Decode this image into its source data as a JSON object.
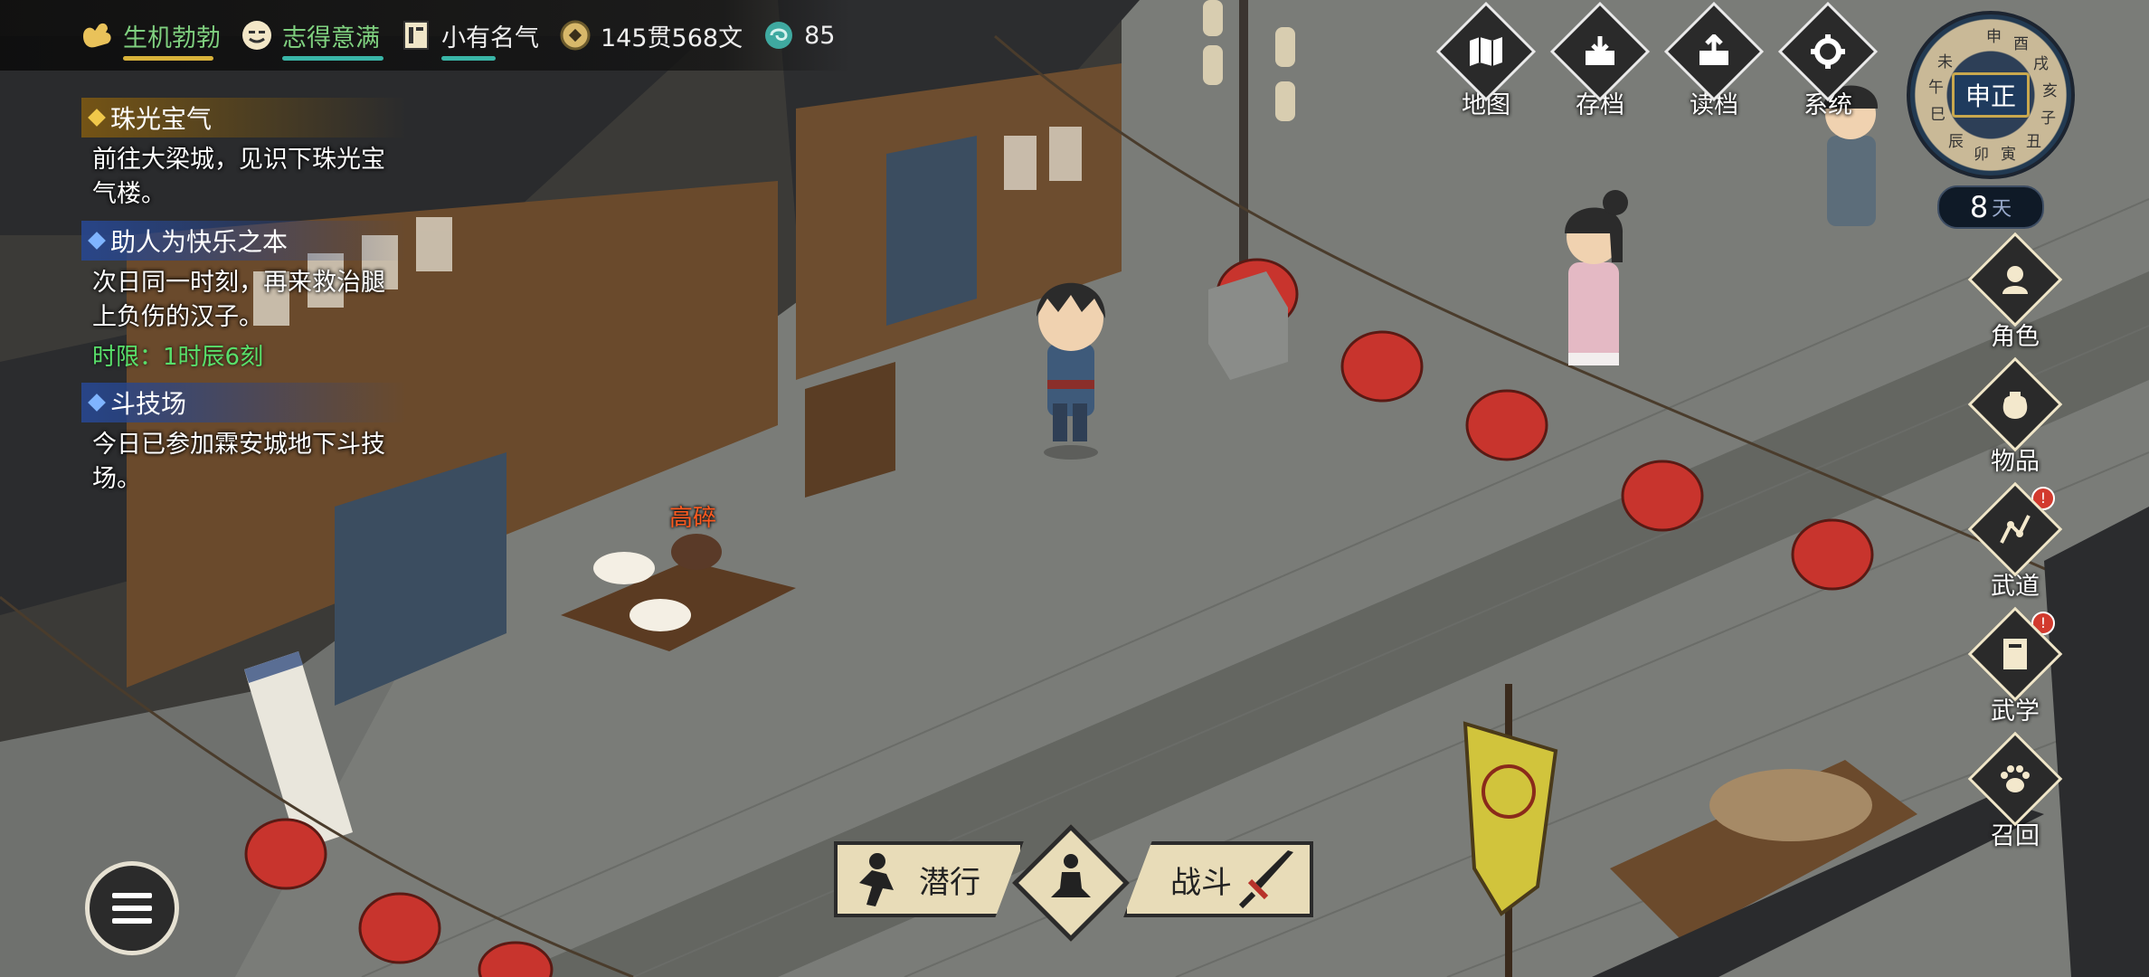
{
  "status_bar": {
    "health": {
      "label": "生机勃勃",
      "icon": "muscle-icon",
      "bar_color": "#d8b23a"
    },
    "mood": {
      "label": "志得意满",
      "icon": "smile-face-icon",
      "bar_color": "#3ab6a8"
    },
    "fame": {
      "label": "小有名气",
      "icon": "scroll-icon",
      "bar_color": "#3ab6a8"
    },
    "money": {
      "label": "145贯568文",
      "icon": "coin-icon"
    },
    "jade": {
      "label": "85",
      "icon": "jade-icon"
    }
  },
  "quests": [
    {
      "title": "珠光宝气",
      "style": "gold",
      "desc": "前往大梁城，见识下珠光宝气楼。"
    },
    {
      "title": "助人为快乐之本",
      "style": "blue",
      "desc": "次日同一时刻，再来救治腿上负伤的汉子。",
      "limit": "时限：1时辰6刻"
    },
    {
      "title": "斗技场",
      "style": "blue",
      "desc": "今日已参加霖安城地下斗技场。"
    }
  ],
  "top_buttons": [
    {
      "label": "地图",
      "icon": "map-icon"
    },
    {
      "label": "存档",
      "icon": "save-icon"
    },
    {
      "label": "读档",
      "icon": "load-icon"
    },
    {
      "label": "系统",
      "icon": "gear-icon"
    }
  ],
  "clock": {
    "current": "申正",
    "glyphs": [
      "申",
      "酉",
      "戌",
      "亥",
      "子",
      "丑",
      "寅",
      "卯",
      "辰",
      "巳",
      "午",
      "未"
    ]
  },
  "days": {
    "value": "8",
    "unit": "天"
  },
  "side_menu": [
    {
      "label": "角色",
      "icon": "character-icon",
      "badge": ""
    },
    {
      "label": "物品",
      "icon": "bag-icon",
      "badge": ""
    },
    {
      "label": "武道",
      "icon": "martial-path-icon",
      "badge": "!"
    },
    {
      "label": "武学",
      "icon": "book-icon",
      "badge": "!"
    },
    {
      "label": "召回",
      "icon": "paw-icon",
      "badge": ""
    }
  ],
  "actions": {
    "sneak": "潜行",
    "fight": "战斗",
    "meditate_icon": "meditate-icon"
  },
  "npc_label": "高碎",
  "colors": {
    "quest_limit": "#58e06a",
    "npc_name": "#ff5a1f",
    "panel_cream": "#e8dcb8"
  }
}
